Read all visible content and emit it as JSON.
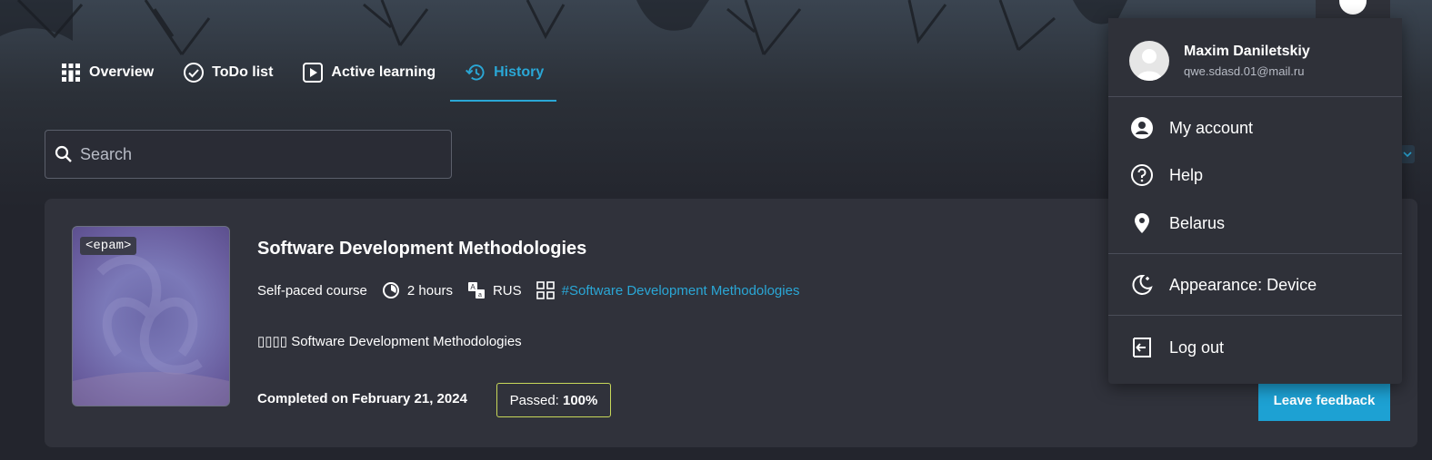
{
  "tabs": [
    {
      "label": "Overview",
      "icon": "grid-icon",
      "active": false
    },
    {
      "label": "ToDo list",
      "icon": "check-circle-icon",
      "active": false
    },
    {
      "label": "Active learning",
      "icon": "play-icon",
      "active": false
    },
    {
      "label": "History",
      "icon": "history-icon",
      "active": true
    }
  ],
  "search": {
    "placeholder": "Search"
  },
  "course": {
    "logo": "<epam>",
    "title": "Software Development Methodologies",
    "type": "Self-paced course",
    "duration": "2 hours",
    "language": "RUS",
    "tag": "#Software Development Methodologies",
    "desc_glyphs": "▯▯▯▯",
    "description": "Software Development Methodologies",
    "completed": "Completed on February 21, 2024",
    "passed_label": "Passed:",
    "passed_value": "100%",
    "feedback_button": "Leave feedback"
  },
  "user_menu": {
    "name": "Maxim Daniletskiy",
    "email": "qwe.sdasd.01@mail.ru",
    "items": [
      {
        "label": "My account",
        "icon": "account-icon"
      },
      {
        "label": "Help",
        "icon": "help-icon"
      },
      {
        "label": "Belarus",
        "icon": "location-pin-icon"
      },
      {
        "label": "Appearance: Device",
        "icon": "moon-icon"
      },
      {
        "label": "Log out",
        "icon": "logout-icon"
      }
    ]
  },
  "colors": {
    "accent": "#2aa7d6",
    "button": "#1da1d3",
    "passed_border": "#c8d85a",
    "card": "#30323b",
    "background": "#23252d"
  }
}
